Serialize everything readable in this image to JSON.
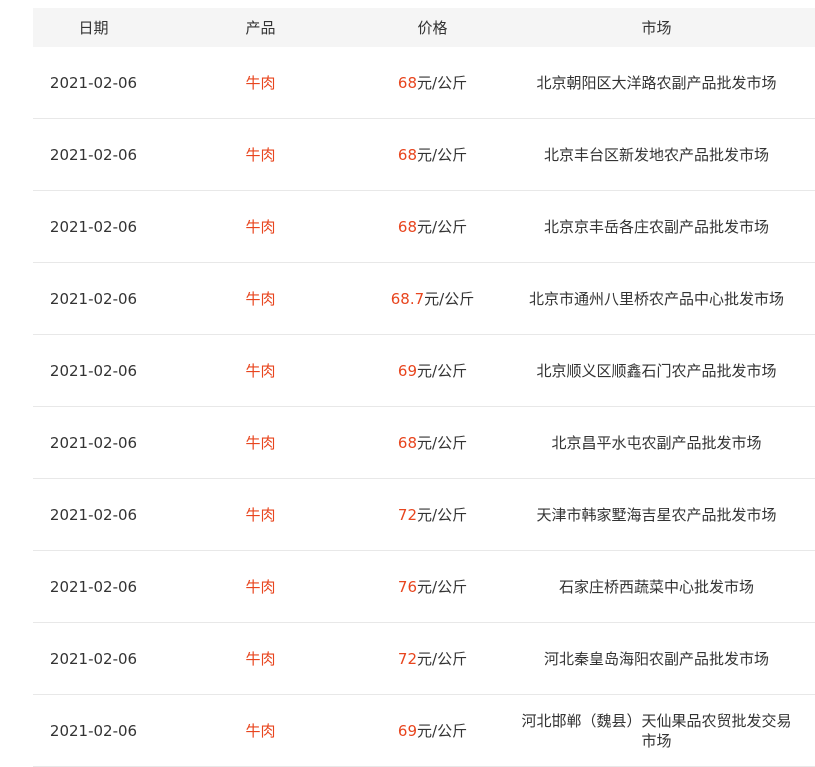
{
  "headers": {
    "date": "日期",
    "product": "产品",
    "price": "价格",
    "market": "市场"
  },
  "rows": [
    {
      "date": "2021-02-06",
      "product": "牛肉",
      "price": "68",
      "unit": "元/公斤",
      "market": "北京朝阳区大洋路农副产品批发市场"
    },
    {
      "date": "2021-02-06",
      "product": "牛肉",
      "price": "68",
      "unit": "元/公斤",
      "market": "北京丰台区新发地农产品批发市场"
    },
    {
      "date": "2021-02-06",
      "product": "牛肉",
      "price": "68",
      "unit": "元/公斤",
      "market": "北京京丰岳各庄农副产品批发市场"
    },
    {
      "date": "2021-02-06",
      "product": "牛肉",
      "price": "68.7",
      "unit": "元/公斤",
      "market": "北京市通州八里桥农产品中心批发市场"
    },
    {
      "date": "2021-02-06",
      "product": "牛肉",
      "price": "69",
      "unit": "元/公斤",
      "market": "北京顺义区顺鑫石门农产品批发市场"
    },
    {
      "date": "2021-02-06",
      "product": "牛肉",
      "price": "68",
      "unit": "元/公斤",
      "market": "北京昌平水屯农副产品批发市场"
    },
    {
      "date": "2021-02-06",
      "product": "牛肉",
      "price": "72",
      "unit": "元/公斤",
      "market": "天津市韩家墅海吉星农产品批发市场"
    },
    {
      "date": "2021-02-06",
      "product": "牛肉",
      "price": "76",
      "unit": "元/公斤",
      "market": "石家庄桥西蔬菜中心批发市场"
    },
    {
      "date": "2021-02-06",
      "product": "牛肉",
      "price": "72",
      "unit": "元/公斤",
      "market": "河北秦皇岛海阳农副产品批发市场"
    },
    {
      "date": "2021-02-06",
      "product": "牛肉",
      "price": "69",
      "unit": "元/公斤",
      "market": "河北邯郸（魏县）天仙果品农贸批发交易市场"
    }
  ]
}
